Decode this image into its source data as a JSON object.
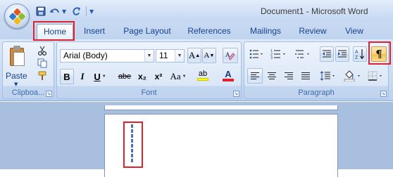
{
  "window": {
    "title": "Document1 - Microsoft Word"
  },
  "qat": {
    "icons": [
      "save-icon",
      "undo-icon",
      "redo-icon",
      "customize-icon"
    ]
  },
  "tabs": [
    {
      "label": "Home",
      "active": true
    },
    {
      "label": "Insert",
      "active": false
    },
    {
      "label": "Page Layout",
      "active": false
    },
    {
      "label": "References",
      "active": false
    },
    {
      "label": "Mailings",
      "active": false
    },
    {
      "label": "Review",
      "active": false
    },
    {
      "label": "View",
      "active": false
    }
  ],
  "ribbon": {
    "clipboard": {
      "label": "Clipboa...",
      "paste_label": "Paste"
    },
    "font": {
      "label": "Font",
      "font_name": "Arial (Body)",
      "font_size": "11",
      "bold": "B",
      "italic": "I",
      "underline": "U",
      "strikethrough": "abe",
      "subscript": "x₂",
      "superscript": "x²",
      "change_case": "Aa",
      "grow": "A",
      "shrink": "A",
      "highlight": "ab",
      "font_color": "A"
    },
    "paragraph": {
      "label": "Paragraph",
      "show_hide": "¶",
      "show_hide_selected": true
    }
  },
  "colors": {
    "accent": "#15428b",
    "highlight_box": "#e0202a",
    "selected_button": "#f7c14a",
    "highlight_yellow": "#ffff00",
    "font_color_red": "#e0202a"
  }
}
